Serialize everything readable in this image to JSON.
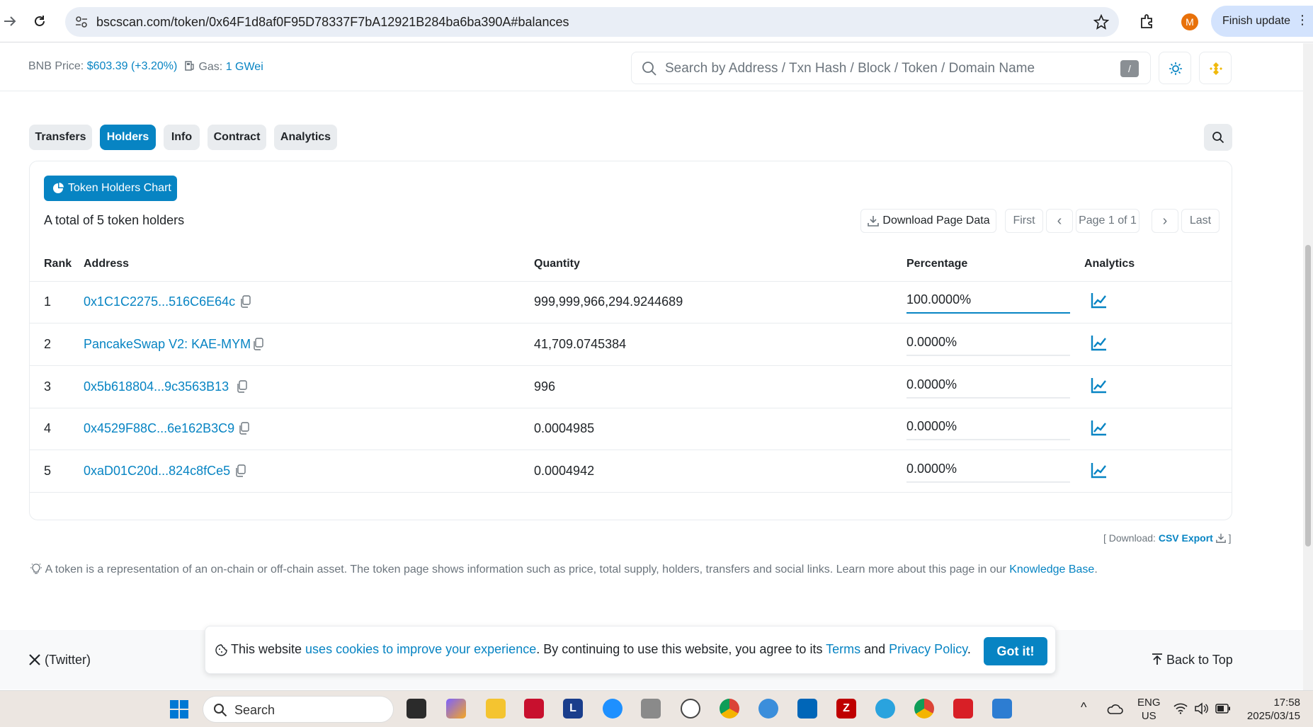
{
  "browser": {
    "url": "bscscan.com/token/0x64F1d8af0F95D78337F7bA12921B284ba6ba390A#balances",
    "finish_update": "Finish update",
    "avatar_letter": "M"
  },
  "header": {
    "bnb_label": "BNB Price: ",
    "bnb_value": "$603.39 (+3.20%)",
    "gas_label": "Gas: ",
    "gas_value": "1 GWei",
    "search_placeholder": "Search by Address / Txn Hash / Block / Token / Domain Name",
    "slash_key": "/"
  },
  "tabs": [
    {
      "label": "Transfers",
      "active": false
    },
    {
      "label": "Holders",
      "active": true
    },
    {
      "label": "Info",
      "active": false
    },
    {
      "label": "Contract",
      "active": false
    },
    {
      "label": "Analytics",
      "active": false
    }
  ],
  "holders": {
    "chart_button": "Token Holders Chart",
    "total_text": "A total of 5 token holders",
    "download_page": "Download Page Data",
    "first": "First",
    "prev": "‹",
    "page": "Page 1 of 1",
    "next": "›",
    "last": "Last",
    "columns": {
      "rank": "Rank",
      "address": "Address",
      "quantity": "Quantity",
      "percentage": "Percentage",
      "analytics": "Analytics"
    },
    "rows": [
      {
        "rank": "1",
        "address": "0x1C1C2275...516C6E64c",
        "quantity": "999,999,966,294.9244689",
        "percentage": "100.0000%",
        "share": 1.0
      },
      {
        "rank": "2",
        "address": "PancakeSwap V2: KAE-MYM",
        "quantity": "41,709.0745384",
        "percentage": "0.0000%",
        "share": 0.0
      },
      {
        "rank": "3",
        "address": "0x5b618804...9c3563B13",
        "quantity": "996",
        "percentage": "0.0000%",
        "share": 0.0
      },
      {
        "rank": "4",
        "address": "0x4529F88C...6e162B3C9",
        "quantity": "0.0004985",
        "percentage": "0.0000%",
        "share": 0.0
      },
      {
        "rank": "5",
        "address": "0xaD01C20d...824c8fCe5",
        "quantity": "0.0004942",
        "percentage": "0.0000%",
        "share": 0.0
      }
    ]
  },
  "download": {
    "prefix": "[ Download: ",
    "csv": "CSV Export",
    "suffix": " ]"
  },
  "info": {
    "text": "A token is a representation of an on-chain or off-chain asset. The token page shows information such as price, total supply, holders, transfers and social links. Learn more about this page in our ",
    "link": "Knowledge Base",
    "end": "."
  },
  "footer": {
    "twitter": "(Twitter)",
    "back_to_top": "Back to Top"
  },
  "cookie": {
    "t1": "This website ",
    "l1": "uses cookies to improve your experience",
    "t2": ". By continuing to use this website, you agree to its ",
    "l2": "Terms",
    "t3": " and ",
    "l3": "Privacy Policy",
    "t4": ".",
    "button": "Got it!"
  },
  "taskbar": {
    "search": "Search",
    "lang1": "ENG",
    "lang2": "US",
    "time": "17:58",
    "date": "2025/03/15"
  },
  "colors": {
    "accent": "#0784c3",
    "muted": "#6c757d"
  }
}
